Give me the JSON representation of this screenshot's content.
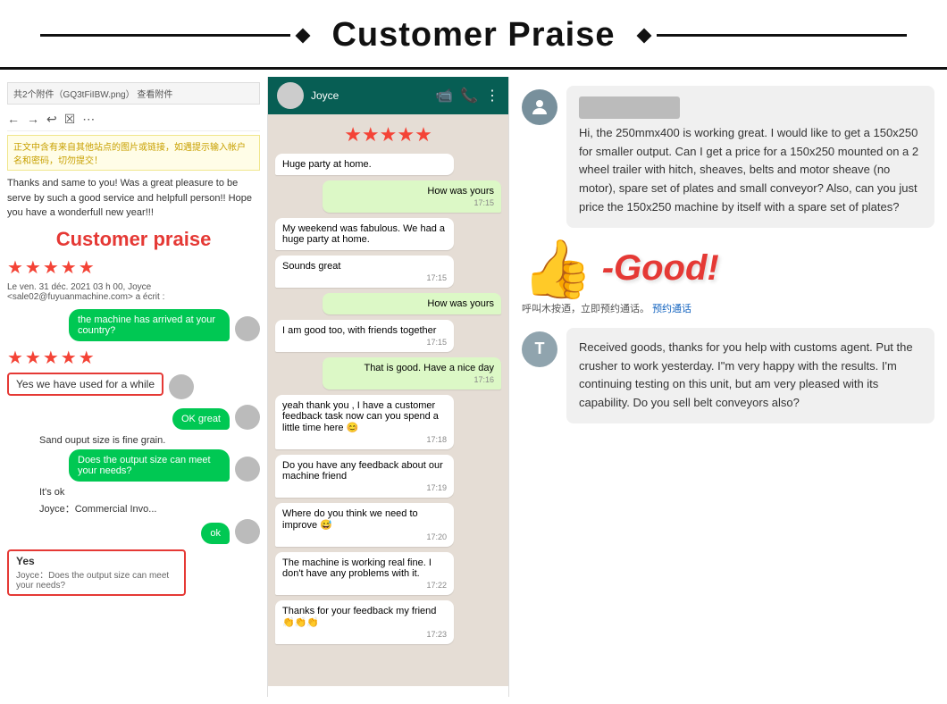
{
  "header": {
    "title": "Customer Praise"
  },
  "email": {
    "attachment_info": "共2个附件（GQ3tFiIBW.png）  查看附件",
    "warning": "正文中含有来自其他站点的图片或链接，如遇提示输入帐户名和密码，切勿提交！",
    "body_text": "Thanks and same to you! Was a great pleasure to be serve by such a good service and helpfull person!! Hope you have a wonderfull new year!!!",
    "praise_title": "Customer praise",
    "from_line": "Le ven. 31 déc. 2021 03 h 00, Joyce <sale02@fuyuanmachine.com> a écrit :",
    "chat": {
      "bubble1": "the machine has arrived at your country?",
      "highlight1": "Yes we have used for a while",
      "bubble2": "OK great",
      "plain1": "Sand ouput size is fine grain.",
      "bubble3": "Does the output size can meet your needs?",
      "plain2": "It's ok",
      "attachment": "Joyce：Commercial Invo...",
      "bubble4": "ok",
      "highlight2_title": "Yes",
      "highlight2_sub": "Joyce：Does the output size can meet your needs?"
    }
  },
  "whatsapp": {
    "contact": "Joyce",
    "stars": "★★★★★",
    "messages": [
      {
        "type": "received",
        "text": "Huge party at home.",
        "time": ""
      },
      {
        "type": "sent",
        "text": "How was yours",
        "time": "17:15"
      },
      {
        "type": "received",
        "text": "My weekend was fabulous. We had a huge party at home.",
        "time": ""
      },
      {
        "type": "received",
        "text": "Sounds great",
        "time": "17:15"
      },
      {
        "type": "sent",
        "text": "How was yours",
        "time": ""
      },
      {
        "type": "received",
        "text": "I am good too, with friends together",
        "time": "17:15"
      },
      {
        "type": "sent",
        "text": "That is good. Have a nice day",
        "time": "17:16"
      },
      {
        "type": "received",
        "text": "yeah thank you , I have a customer feedback task now can you spend a little time here 😊",
        "time": "17:18"
      },
      {
        "type": "received",
        "text": "Do you have any feedback about our machine friend",
        "time": "17:19"
      },
      {
        "type": "received",
        "text": "Where do you think we need to improve 😅",
        "time": "17:20"
      },
      {
        "type": "received",
        "text": "The machine is working real fine. I don't have any problems with it.",
        "time": "17:22"
      },
      {
        "type": "received",
        "text": "Thanks for your feedback my friend 👏👏👏",
        "time": "17:23"
      }
    ]
  },
  "reviews": {
    "review1_text": "Hi, the 250mmx400 is working great. I would like to get a 150x250 for smaller output. Can I get a price for a 150x250 mounted on a 2 wheel trailer with hitch, sheaves, belts and motor sheave (no motor), spare set of plates and small conveyor? Also, can you just price the 150x250 machine by itself with a spare set of plates?",
    "good_label": "-Good!",
    "chinese_text": "呼叫木按迺，立即预约通话。",
    "chinese_link": "预约通话",
    "review2_text": "Received goods, thanks for you help with customs agent. Put the crusher to work yesterday. I\"m very happy with the results. I'm continuing testing on this unit, but am very pleased with its capability. Do you sell belt conveyors also?",
    "reviewer2_initial": "T"
  }
}
